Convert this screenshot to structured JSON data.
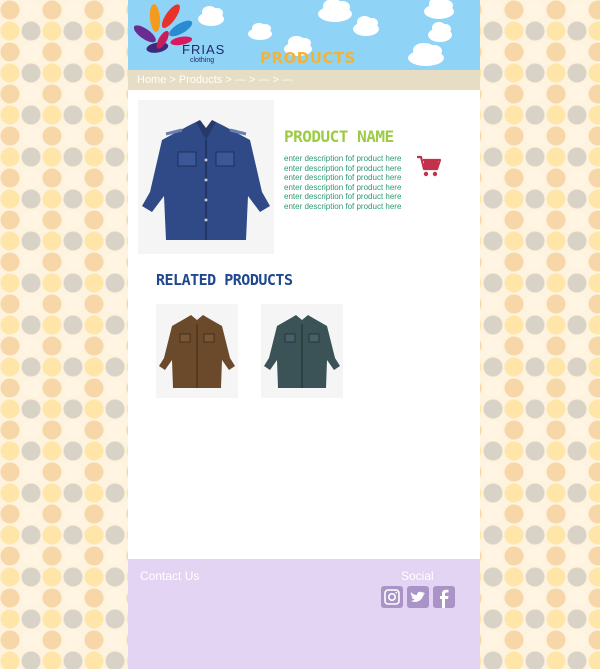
{
  "header": {
    "logo_text": "FRIAS",
    "logo_subtext": "clothing",
    "page_title": "PRODUCTS"
  },
  "breadcrumb": [
    "Home",
    "Products",
    "---",
    "---",
    "---"
  ],
  "breadcrumb_separator": " > ",
  "product": {
    "name": "PRODUCT NAME",
    "description_lines": [
      "enter description fof product here",
      "enter description fof product here",
      "enter description fof product here",
      "enter description fof product here",
      "enter description fof product here",
      "enter description fof product here"
    ],
    "image_icon": "blue-denim-shirt",
    "cart_icon": "shopping-cart-icon"
  },
  "related": {
    "title": "RELATED PRODUCTS",
    "items": [
      {
        "icon": "brown-shirt",
        "color": "#6b4a2b"
      },
      {
        "icon": "teal-shirt",
        "color": "#3b5256"
      }
    ]
  },
  "footer": {
    "contact_label": "Contact Us",
    "social_label": "Social",
    "social_icons": [
      "instagram-icon",
      "twitter-icon",
      "facebook-icon"
    ]
  },
  "colors": {
    "header_bg": "#8fd3f6",
    "accent_orange": "#f5b335",
    "product_name_green": "#9ccc44",
    "description_green": "#2a9b70",
    "related_blue": "#21488f",
    "cart_red": "#c4314b",
    "footer_bg": "#e3d4f4",
    "social_icon": "#a993c7"
  }
}
